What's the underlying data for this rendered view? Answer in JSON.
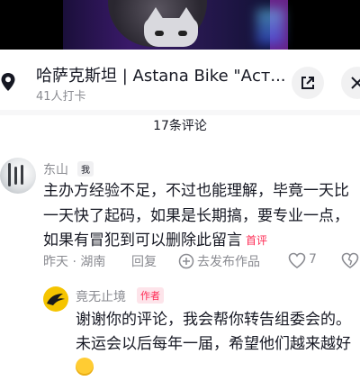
{
  "location": {
    "title": "哈萨克斯坦 | Astana Bike \"Аст...",
    "checkins": "41人打卡"
  },
  "comments_count": "17条评论",
  "comment1": {
    "username": "东山",
    "me_badge": "我",
    "text": "主办方经验不足，不过也能理解，毕竟一天比一天快了起码，如果是长期搞，要专业一点，如果有冒犯到可以删除此留言",
    "first_tag": "首评",
    "time_location": "昨天 · 湖南",
    "reply_label": "回复",
    "share_label": "去发布作品",
    "like_count": "7"
  },
  "comment2": {
    "username": "竟无止境",
    "author_badge": "作者",
    "text": "谢谢你的评论，我会帮你转告组委会的。未运会以后每年一届，希望他们越来越好"
  },
  "icons": [
    "location-pin-icon",
    "share-icon",
    "close-icon",
    "add-circle-icon",
    "heart-icon",
    "dislike-icon",
    "emoji-icon"
  ],
  "colors": {
    "accent": "#fe2c55",
    "muted": "#8a8b91",
    "text": "#161823"
  }
}
